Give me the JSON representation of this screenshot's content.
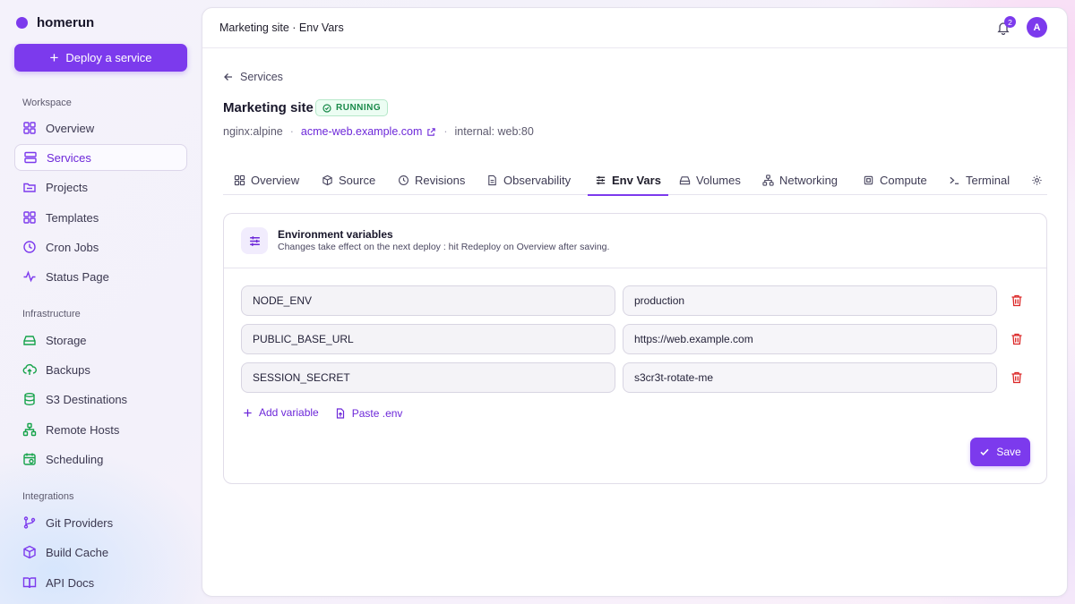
{
  "brand": {
    "name": "homerun"
  },
  "sidebar": {
    "deploy_label": "Deploy a service",
    "sections": {
      "workspace": "Workspace",
      "infrastructure": "Infrastructure",
      "integrations": "Integrations"
    },
    "items": [
      {
        "label": "Overview",
        "icon": "grid-icon"
      },
      {
        "label": "Services",
        "icon": "server-icon"
      },
      {
        "label": "Projects",
        "icon": "folder-icon"
      },
      {
        "label": "Templates",
        "icon": "template-icon"
      },
      {
        "label": "Cron Jobs",
        "icon": "clock-icon"
      },
      {
        "label": "Status Page",
        "icon": "pulse-icon"
      },
      {
        "label": "Storage",
        "icon": "hard-drive-icon"
      },
      {
        "label": "Backups",
        "icon": "cloud-upload-icon"
      },
      {
        "label": "S3 Destinations",
        "icon": "database-icon"
      },
      {
        "label": "Remote Hosts",
        "icon": "network-icon"
      },
      {
        "label": "Scheduling",
        "icon": "calendar-clock-icon"
      },
      {
        "label": "Git Providers",
        "icon": "git-branch-icon"
      },
      {
        "label": "Build Cache",
        "icon": "box-icon"
      },
      {
        "label": "API Docs",
        "icon": "book-icon"
      }
    ]
  },
  "topbar": {
    "title": "Marketing site · Env Vars",
    "notifications": "2",
    "avatar_initial": "A"
  },
  "header": {
    "back_label": "Services",
    "title": "Marketing site",
    "status": "RUNNING",
    "image": "nginx:alpine",
    "dot": "·",
    "domain": "acme-web.example.com",
    "internal": "internal: web:80"
  },
  "tabs": [
    "Overview",
    "Source",
    "Revisions",
    "Observability",
    "Env Vars",
    "Volumes",
    "Networking",
    "Compute",
    "Terminal"
  ],
  "card": {
    "title": "Environment variables",
    "subtitle": "Changes take effect on the next deploy : hit Redeploy on Overview after saving.",
    "vars": [
      {
        "key": "NODE_ENV",
        "value": "production"
      },
      {
        "key": "PUBLIC_BASE_URL",
        "value": "https://web.example.com"
      },
      {
        "key": "SESSION_SECRET",
        "value": "s3cr3t-rotate-me"
      }
    ],
    "add_label": "Add variable",
    "paste_label": "Paste .env",
    "save_label": "Save"
  },
  "colors": {
    "accent": "#7c3aed",
    "running": "#1a8a4a",
    "danger": "#dc2626"
  }
}
